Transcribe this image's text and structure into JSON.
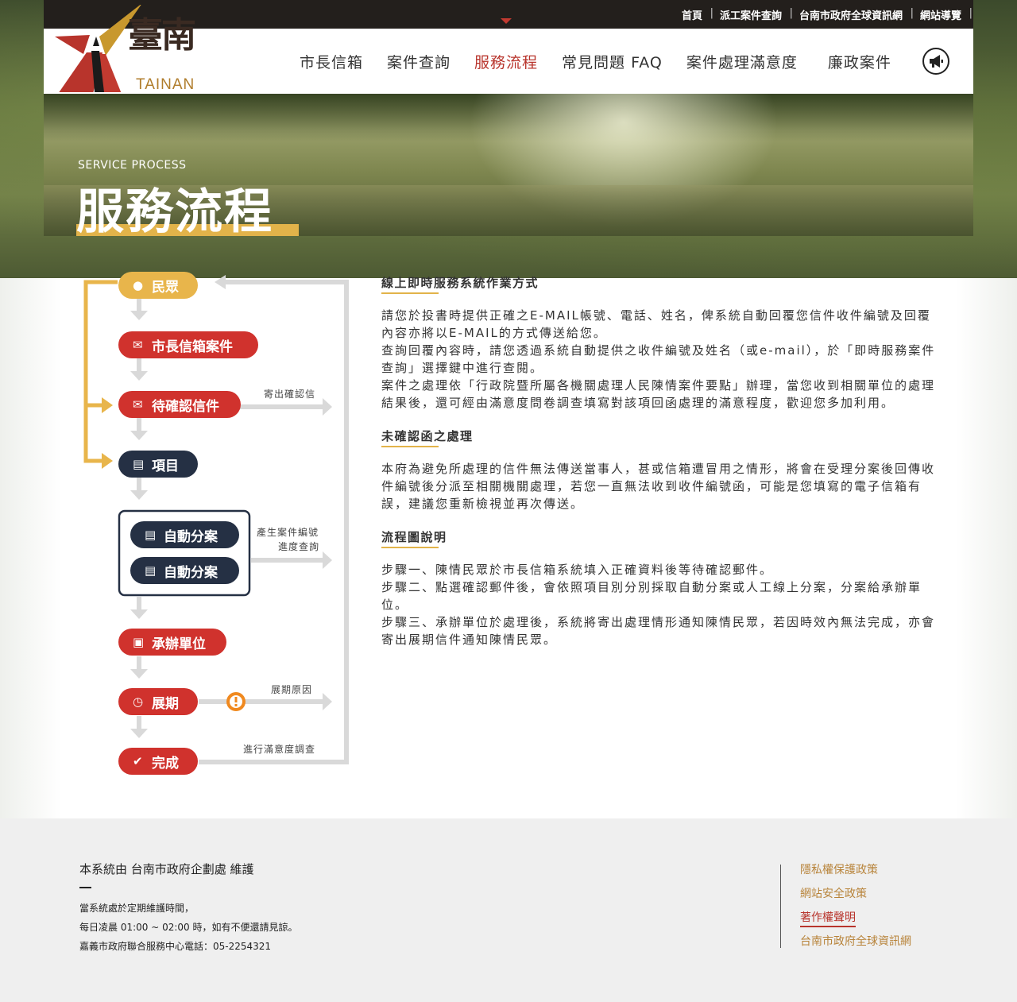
{
  "topbar": {
    "links": [
      "首頁",
      "派工案件查詢",
      "台南市政府全球資訊網",
      "網站導覽"
    ]
  },
  "logo": {
    "text_cn": "臺南",
    "text_en": "TAINAN"
  },
  "nav": {
    "items": [
      "市長信箱",
      "案件查詢",
      "服務流程",
      "常見問題 FAQ",
      "案件處理滿意度",
      "廉政案件"
    ],
    "active": "服務流程",
    "megaphone_icon": "megaphone-icon"
  },
  "banner": {
    "subtitle": "SERVICE PROCESS",
    "title": "服務流程"
  },
  "flow": {
    "steps": {
      "citizen": "民眾",
      "mayor_mail": "市長信箱案件",
      "pending_mail": "待確認信件",
      "item": "項目",
      "auto1": "自動分案",
      "auto2": "自動分案",
      "unit": "承辦單位",
      "extend": "展期",
      "done": "完成"
    },
    "labels": {
      "send_confirm": "寄出確認信",
      "gen_number": "產生案件編號",
      "progress": "進度查詢",
      "extend_reason": "展期原因",
      "survey": "進行滿意度調查"
    },
    "colors": {
      "red": "#d0322d",
      "yellow": "#e8b54b",
      "navy": "#253044",
      "gray": "#d9d9d9",
      "orange": "#f0891f"
    }
  },
  "content": {
    "sections": [
      {
        "heading": "線上即時服務系統作業方式",
        "lines": [
          "請您於投書時提供正確之E-MAIL帳號、電話、姓名，俾系統自動回覆您信件收件編號及回覆內容亦將以E-MAIL的方式傳送給您。",
          "查詢回覆內容時，請您透過系統自動提供之收件編號及姓名（或e-mail），於「即時服務案件查詢」選擇鍵中進行查閱。",
          "案件之處理依「行政院暨所屬各機關處理人民陳情案件要點」辦理，當您收到相關單位的處理結果後，還可經由滿意度問卷調查填寫對該項回函處理的滿意程度，歡迎您多加利用。"
        ]
      },
      {
        "heading": "未確認函之處理",
        "lines": [
          "本府為避免所處理的信件無法傳送當事人，甚或信箱遭冒用之情形，將會在受理分案後回傳收件編號後分派至相關機關處理，若您一直無法收到收件編號函，可能是您填寫的電子信箱有誤，建議您重新檢視並再次傳送。"
        ]
      },
      {
        "heading": "流程圖說明",
        "lines": [
          "步驟一、陳情民眾於市長信箱系統填入正確資料後等待確認郵件。",
          "步驟二、點選確認郵件後，會依照項目別分別採取自動分案或人工線上分案，分案給承辦單位。",
          "步驟三、承辦單位於處理後，系統將寄出處理情形通知陳情民眾，若因時效內無法完成，亦會寄出展期信件通知陳情民眾。"
        ]
      }
    ]
  },
  "footer": {
    "title": "本系統由 台南市政府企劃處 維護",
    "notes": [
      "當系統處於定期維護時間，",
      "每日凌晨 01:00 ~ 02:00 時，如有不便還請見諒。",
      "嘉義市政府聯合服務中心電話：05-2254321"
    ],
    "links": [
      "隱私權保護政策",
      "網站安全政策",
      "著作權聲明",
      "台南市政府全球資訊網"
    ],
    "active_link": "著作權聲明"
  }
}
